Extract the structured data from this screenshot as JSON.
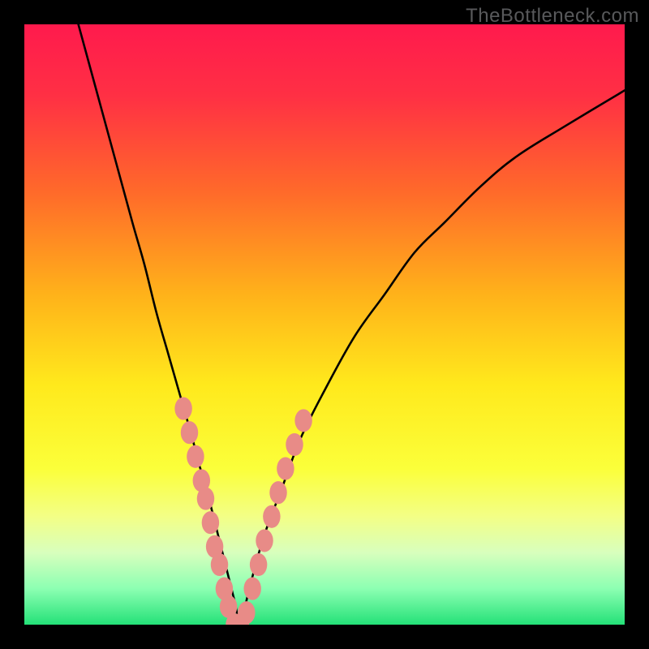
{
  "watermark": "TheBottleneck.com",
  "chart_data": {
    "type": "line",
    "title": "",
    "xlabel": "",
    "ylabel": "",
    "xlim": [
      0,
      100
    ],
    "ylim": [
      0,
      100
    ],
    "grid": false,
    "legend": false,
    "annotations": [],
    "background_gradient": {
      "stops": [
        {
          "pct": 0,
          "color": "#ff1a4d"
        },
        {
          "pct": 12,
          "color": "#ff3044"
        },
        {
          "pct": 28,
          "color": "#ff6a2a"
        },
        {
          "pct": 45,
          "color": "#ffb21a"
        },
        {
          "pct": 60,
          "color": "#ffe91c"
        },
        {
          "pct": 74,
          "color": "#fbff3a"
        },
        {
          "pct": 82,
          "color": "#f3ff86"
        },
        {
          "pct": 88,
          "color": "#d8ffbd"
        },
        {
          "pct": 94,
          "color": "#8cffb2"
        },
        {
          "pct": 100,
          "color": "#24e178"
        }
      ]
    },
    "series": [
      {
        "name": "bottleneck-curve",
        "x": [
          9,
          12,
          15,
          18,
          20,
          22,
          24,
          26,
          28,
          29,
          30,
          31,
          32,
          33,
          34,
          35,
          36,
          37,
          38,
          40,
          43,
          46,
          50,
          55,
          60,
          65,
          70,
          76,
          82,
          90,
          100
        ],
        "y": [
          100,
          89,
          78,
          67,
          60,
          52,
          45,
          38,
          31,
          27,
          24,
          20,
          16,
          12,
          8,
          4,
          0,
          4,
          8,
          15,
          23,
          31,
          39,
          48,
          55,
          62,
          67,
          73,
          78,
          83,
          89
        ]
      }
    ],
    "markers": {
      "name": "highlight-points",
      "color": "#e88b87",
      "points": [
        {
          "x": 26.5,
          "y": 36
        },
        {
          "x": 27.5,
          "y": 32
        },
        {
          "x": 28.5,
          "y": 28
        },
        {
          "x": 29.5,
          "y": 24
        },
        {
          "x": 30.2,
          "y": 21
        },
        {
          "x": 31.0,
          "y": 17
        },
        {
          "x": 31.7,
          "y": 13
        },
        {
          "x": 32.5,
          "y": 10
        },
        {
          "x": 33.3,
          "y": 6
        },
        {
          "x": 34.0,
          "y": 3
        },
        {
          "x": 35.0,
          "y": 0
        },
        {
          "x": 36.0,
          "y": 0
        },
        {
          "x": 37.0,
          "y": 2
        },
        {
          "x": 38.0,
          "y": 6
        },
        {
          "x": 39.0,
          "y": 10
        },
        {
          "x": 40.0,
          "y": 14
        },
        {
          "x": 41.2,
          "y": 18
        },
        {
          "x": 42.3,
          "y": 22
        },
        {
          "x": 43.5,
          "y": 26
        },
        {
          "x": 45.0,
          "y": 30
        },
        {
          "x": 46.5,
          "y": 34
        }
      ]
    }
  }
}
